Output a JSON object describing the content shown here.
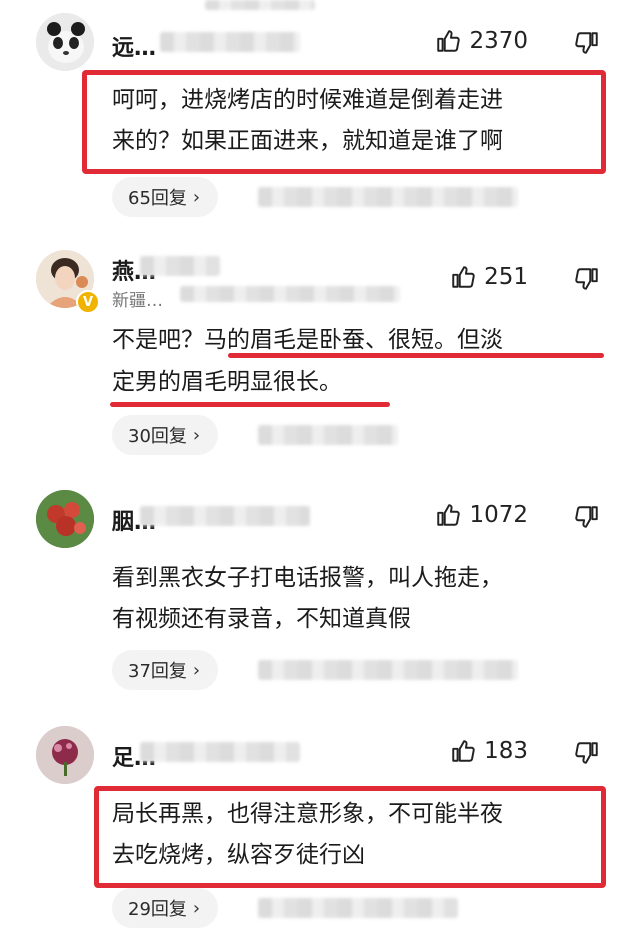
{
  "colors": {
    "highlight": "#e02a36",
    "reply_bg": "#f3f3f3",
    "verified": "#f0b400"
  },
  "icons": {
    "like": "thumbs-up-icon",
    "dislike": "thumbs-down-icon",
    "chevron": "chevron-right-icon"
  },
  "comments": [
    {
      "name": "远…",
      "likes": "2370",
      "lines": [
        "呵呵，进烧烤店的时候难道是倒着走进",
        "来的？如果正面进来，就知道是谁了啊"
      ],
      "replies": "65回复"
    },
    {
      "name": "燕…",
      "location": "新疆…",
      "likes": "251",
      "line1_a": "不是吧？",
      "line1_b": "马的眉毛是卧蚕、很短。但淡",
      "line2": "定男的眉毛明显很长。",
      "replies": "30回复"
    },
    {
      "name": "胭…",
      "likes": "1072",
      "lines": [
        "看到黑衣女子打电话报警，叫人拖走，",
        "有视频还有录音，不知道真假"
      ],
      "replies": "37回复"
    },
    {
      "name": "足…",
      "likes": "183",
      "lines": [
        "局长再黑，也得注意形象，不可能半夜",
        "去吃烧烤，纵容歹徒行凶"
      ],
      "replies": "29回复"
    }
  ]
}
